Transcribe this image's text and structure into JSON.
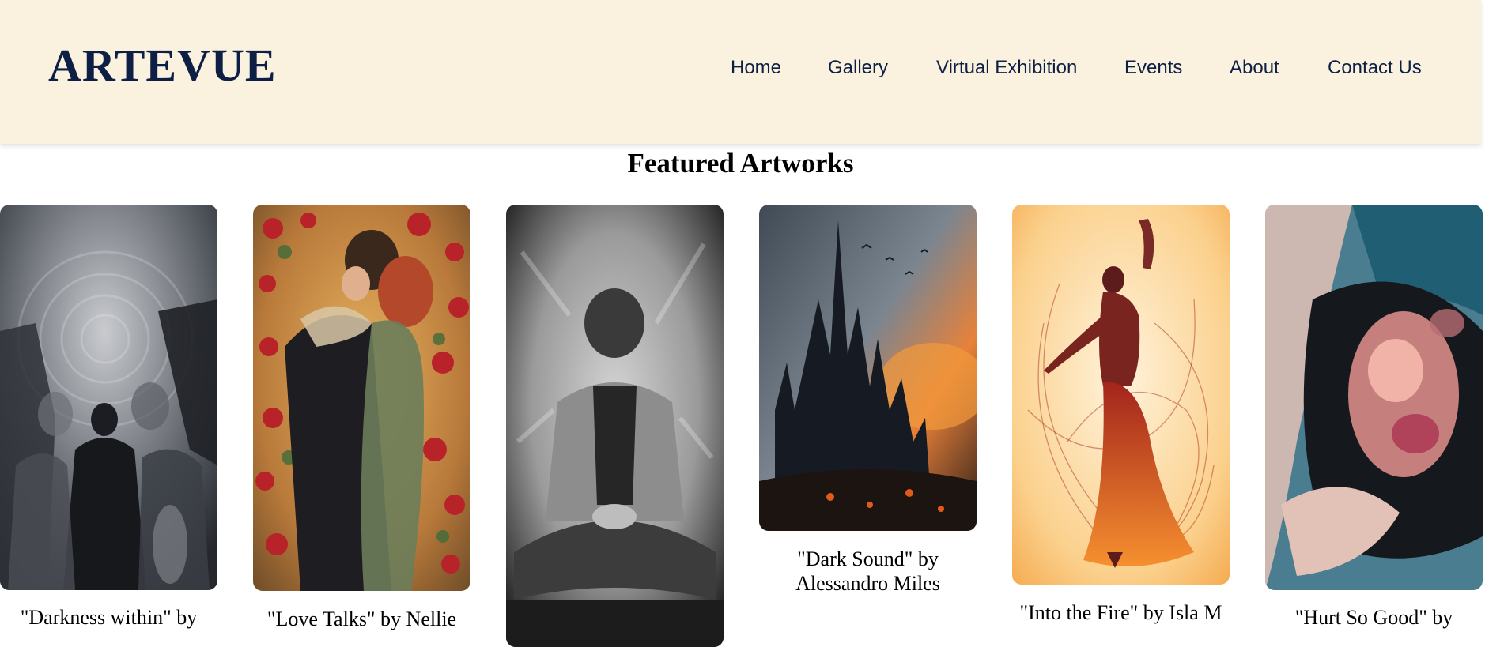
{
  "brand": {
    "logo_text": "ARTEVUE"
  },
  "nav": {
    "items": [
      {
        "label": "Home"
      },
      {
        "label": "Gallery"
      },
      {
        "label": "Virtual Exhibition"
      },
      {
        "label": "Events"
      },
      {
        "label": "About"
      },
      {
        "label": "Contact Us"
      }
    ]
  },
  "featured": {
    "title": "Featured Artworks",
    "artworks": [
      {
        "caption": "\"Darkness within\" by"
      },
      {
        "caption": "\"Love Talks\" by Nellie"
      },
      {
        "caption": ""
      },
      {
        "caption": "\"Dark Sound\" by Alessandro Miles"
      },
      {
        "caption": "\"Into the Fire\" by Isla M"
      },
      {
        "caption": "\"Hurt So Good\" by"
      }
    ]
  }
}
